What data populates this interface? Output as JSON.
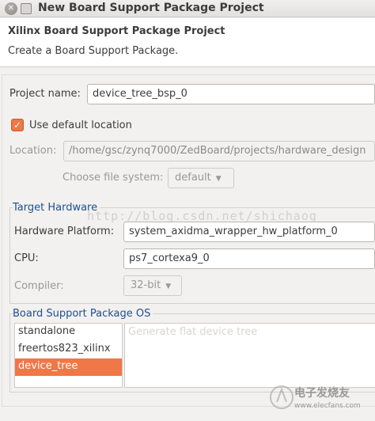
{
  "window": {
    "title": "New Board Support Package Project"
  },
  "header": {
    "title": "Xilinx Board Support Package Project",
    "subtitle": "Create a Board Support Package."
  },
  "project": {
    "name_label": "Project name:",
    "name_value": "device_tree_bsp_0",
    "use_default_label": "Use default location",
    "use_default_checked": true,
    "location_label": "Location:",
    "location_value": "/home/gsc/zynq7000/ZedBoard/projects/hardware_design",
    "file_system_label": "Choose file system:",
    "file_system_value": "default"
  },
  "target_hardware": {
    "group_label": "Target Hardware",
    "platform_label": "Hardware Platform:",
    "platform_value": "system_axidma_wrapper_hw_platform_0",
    "cpu_label": "CPU:",
    "cpu_value": "ps7_cortexa9_0",
    "compiler_label": "Compiler:",
    "compiler_value": "32-bit"
  },
  "bsp_os": {
    "group_label": "Board Support Package OS",
    "items": [
      "standalone",
      "freertos823_xilinx",
      "device_tree"
    ],
    "selected": "device_tree",
    "description": "Generate flat device tree"
  },
  "watermark": {
    "text": "http://blog.csdn.net/shichaog"
  },
  "logo": {
    "name": "电子发烧友",
    "url": "www.elecfans.com"
  },
  "colors": {
    "accent": "#f07746",
    "group_title": "#1f4f8f"
  }
}
